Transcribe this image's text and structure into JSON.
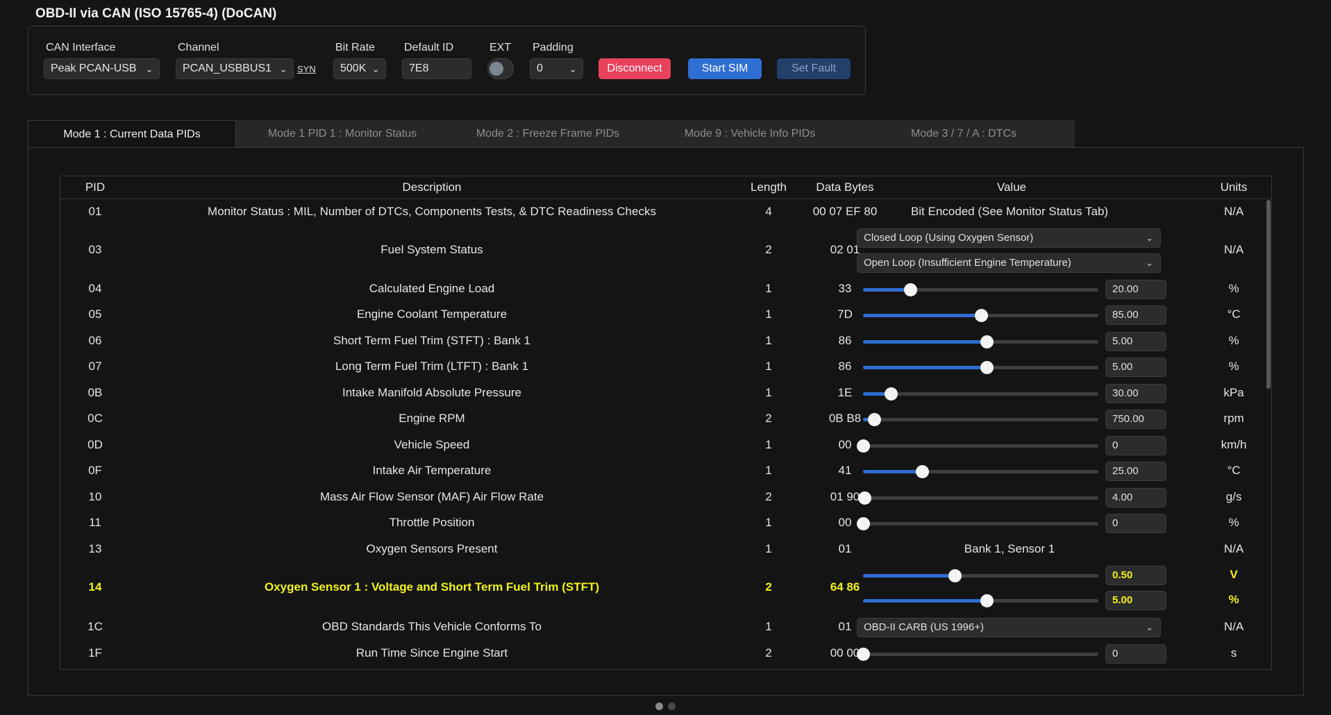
{
  "title": "OBD-II via CAN (ISO 15765-4) (DoCAN)",
  "connection": {
    "can_interface_label": "CAN Interface",
    "can_interface_value": "Peak PCAN-USB",
    "channel_label": "Channel",
    "channel_value": "PCAN_USBBUS1",
    "syn_link": "SYN",
    "bitrate_label": "Bit Rate",
    "bitrate_value": "500K",
    "default_id_label": "Default ID",
    "default_id_value": "7E8",
    "ext_label": "EXT",
    "ext_enabled": false,
    "padding_label": "Padding",
    "padding_value": "0",
    "disconnect_label": "Disconnect",
    "start_sim_label": "Start SIM",
    "set_fault_label": "Set Fault"
  },
  "tabs": [
    {
      "label": "Mode 1  :  Current Data PIDs",
      "active": true
    },
    {
      "label": "Mode 1 PID 1  :  Monitor Status",
      "active": false
    },
    {
      "label": "Mode 2  :  Freeze Frame PIDs",
      "active": false
    },
    {
      "label": "Mode 9  :  Vehicle Info PIDs",
      "active": false
    },
    {
      "label": "Mode 3 / 7 / A  :  DTCs",
      "active": false
    }
  ],
  "table": {
    "headers": {
      "pid": "PID",
      "description": "Description",
      "length": "Length",
      "data_bytes": "Data Bytes",
      "value": "Value",
      "units": "Units"
    },
    "rows": [
      {
        "pid": "01",
        "description": "Monitor Status : MIL, Number of DTCs, Components Tests, & DTC Readiness Checks",
        "length": "4",
        "bytes": "00 07 EF 80",
        "value_text": "Bit Encoded (See Monitor Status Tab)",
        "units": "N/A"
      },
      {
        "pid": "03",
        "description": "Fuel System Status",
        "length": "2",
        "bytes": "02 01",
        "select_1": "Closed Loop (Using Oxygen Sensor)",
        "select_2": "Open Loop (Insufficient Engine Temperature)",
        "units": "N/A"
      },
      {
        "pid": "04",
        "description": "Calculated Engine Load",
        "length": "1",
        "bytes": "33",
        "value": "20.00",
        "level": 0.2,
        "units": "%"
      },
      {
        "pid": "05",
        "description": "Engine Coolant Temperature",
        "length": "1",
        "bytes": "7D",
        "value": "85.00",
        "level": 0.5,
        "units": "°C"
      },
      {
        "pid": "06",
        "description": "Short Term Fuel Trim (STFT) : Bank 1",
        "length": "1",
        "bytes": "86",
        "value": "5.00",
        "level": 0.525,
        "units": "%"
      },
      {
        "pid": "07",
        "description": "Long Term Fuel Trim (LTFT) : Bank 1",
        "length": "1",
        "bytes": "86",
        "value": "5.00",
        "level": 0.525,
        "units": "%"
      },
      {
        "pid": "0B",
        "description": "Intake Manifold Absolute Pressure",
        "length": "1",
        "bytes": "1E",
        "value": "30.00",
        "level": 0.118,
        "units": "kPa"
      },
      {
        "pid": "0C",
        "description": "Engine RPM",
        "length": "2",
        "bytes": "0B B8",
        "value": "750.00",
        "level": 0.046,
        "units": "rpm"
      },
      {
        "pid": "0D",
        "description": "Vehicle Speed",
        "length": "1",
        "bytes": "00",
        "value": "0",
        "level": 0.0,
        "units": "km/h"
      },
      {
        "pid": "0F",
        "description": "Intake Air Temperature",
        "length": "1",
        "bytes": "41",
        "value": "25.00",
        "level": 0.25,
        "units": "°C"
      },
      {
        "pid": "10",
        "description": "Mass Air Flow Sensor (MAF) Air Flow Rate",
        "length": "2",
        "bytes": "01 90",
        "value": "4.00",
        "level": 0.006,
        "units": "g/s"
      },
      {
        "pid": "11",
        "description": "Throttle Position",
        "length": "1",
        "bytes": "00",
        "value": "0",
        "level": 0.0,
        "units": "%"
      },
      {
        "pid": "13",
        "description": "Oxygen Sensors Present",
        "length": "1",
        "bytes": "01",
        "value_text": "Bank 1, Sensor 1",
        "units": "N/A"
      },
      {
        "pid": "14",
        "description": "Oxygen Sensor 1 : Voltage and Short Term Fuel Trim (STFT)",
        "length": "2",
        "bytes": "64 86",
        "value_1": "0.50",
        "level_1": 0.39,
        "units_1": "V",
        "value_2": "5.00",
        "level_2": 0.525,
        "units_2": "%",
        "highlighted": true
      },
      {
        "pid": "1C",
        "description": "OBD Standards This Vehicle Conforms To",
        "length": "1",
        "bytes": "01",
        "select_1": "OBD-II CARB (US 1996+)",
        "units": "N/A"
      },
      {
        "pid": "1F",
        "description": "Run Time Since Engine Start",
        "length": "2",
        "bytes": "00 00",
        "value": "0",
        "level": 0.0,
        "units": "s"
      }
    ]
  },
  "colors": {
    "accent": "#2f6ed3",
    "danger": "#e8415c",
    "highlight": "#f2f21a"
  }
}
